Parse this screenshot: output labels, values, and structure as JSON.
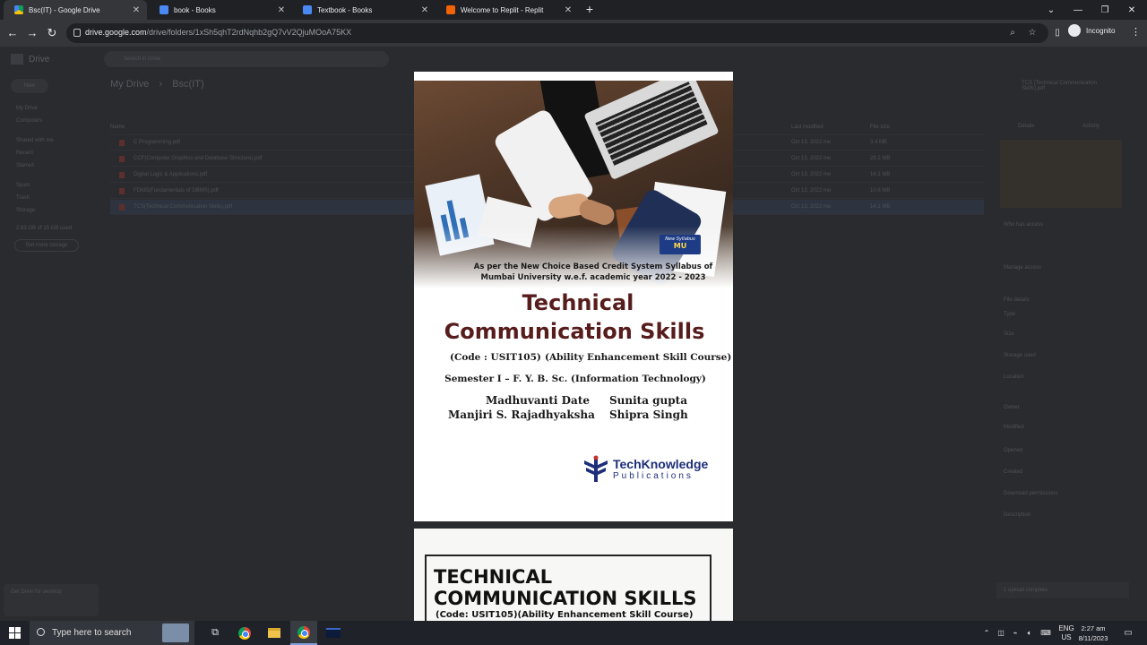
{
  "browser": {
    "tabs": [
      {
        "title": "Bsc(IT) - Google Drive",
        "active": true,
        "favicon": "google-drive-icon"
      },
      {
        "title": "book - Books",
        "active": false,
        "favicon": "books-icon"
      },
      {
        "title": "Textbook - Books",
        "active": false,
        "favicon": "books-icon"
      },
      {
        "title": "Welcome to Replit - Replit",
        "active": false,
        "favicon": "replit-icon"
      }
    ],
    "url_host": "drive.google.com",
    "url_path": "/drive/folders/1xSh5qhT2rdNqhb2gQ7vV2QjuMOoA75KX",
    "profile_label": "Incognito"
  },
  "drive": {
    "app_name": "Drive",
    "search_placeholder": "Search in Drive",
    "new_label": "New",
    "sidebar": [
      "My Drive",
      "Computers",
      "Shared with me",
      "Recent",
      "Starred",
      "Spam",
      "Trash",
      "Storage"
    ],
    "storage_text": "2.63 GB of 15 GB used",
    "storage_button": "Get more storage",
    "breadcrumb_root": "My Drive",
    "breadcrumb_folder": "Bsc(IT)",
    "columns": {
      "name": "Name",
      "modified": "Last modified",
      "size": "File size"
    },
    "files": [
      {
        "name": "C Programming.pdf",
        "modified": "Oct 13, 2022 me",
        "size": "3.4 MB"
      },
      {
        "name": "CCF(Computer Graphics and Database Structure).pdf",
        "modified": "Oct 13, 2022 me",
        "size": "29.2 MB"
      },
      {
        "name": "Digital Logic & Applications.pdf",
        "modified": "Oct 13, 2022 me",
        "size": "16.1 MB"
      },
      {
        "name": "FDMS(Fundamentals of DBMS).pdf",
        "modified": "Oct 13, 2022 me",
        "size": "10.6 MB"
      },
      {
        "name": "TCS(Technical Communication Skills).pdf",
        "modified": "Oct 13, 2022 me",
        "size": "14.1 MB",
        "selected": true
      }
    ],
    "details_title": "TCS (Technical Communication Skills).pdf",
    "details_tabs": [
      "Details",
      "Activity"
    ],
    "details_labels": [
      "Who has access",
      "Manage access",
      "File details",
      "Type",
      "Size",
      "Storage used",
      "Location",
      "Owner",
      "Modified",
      "Opened",
      "Created",
      "Download permissions",
      "Description"
    ],
    "toast_text": "Get Drive for desktop",
    "upload_text": "1 upload complete"
  },
  "pdf": {
    "badge_top": "New Syllabus",
    "badge_bottom": "MU",
    "syllabus_line1": "As per the New Choice Based Credit System Syllabus of",
    "syllabus_line2": "Mumbai University w.e.f. academic year 2022 - 2023",
    "title_line1": "Technical",
    "title_line2": "Communication Skills",
    "code": "(Code : USIT105)",
    "course": "(Ability Enhancement Skill Course)",
    "semester": "Semester I – F. Y. B. Sc. (Information Technology)",
    "authors": [
      "Madhuvanti Date",
      "Manjiri S. Rajadhyaksha",
      "Sunita gupta",
      "Shipra Singh"
    ],
    "publisher_name": "TechKnowledge",
    "publisher_sub": "Publications",
    "page2_line1": "TECHNICAL",
    "page2_line2": "COMMUNICATION SKILLS",
    "page2_line3": "(Code: USIT105)(Ability Enhancement Skill Course)"
  },
  "taskbar": {
    "search_placeholder": "Type here to search",
    "lang_line1": "ENG",
    "lang_line2": "US",
    "time": "2:27 am",
    "date": "8/11/2023"
  },
  "colors": {
    "title_maroon": "#571c1c",
    "publisher_blue": "#1d2e7a",
    "chrome_dark": "#202124",
    "chrome_toolbar": "#35363a"
  }
}
